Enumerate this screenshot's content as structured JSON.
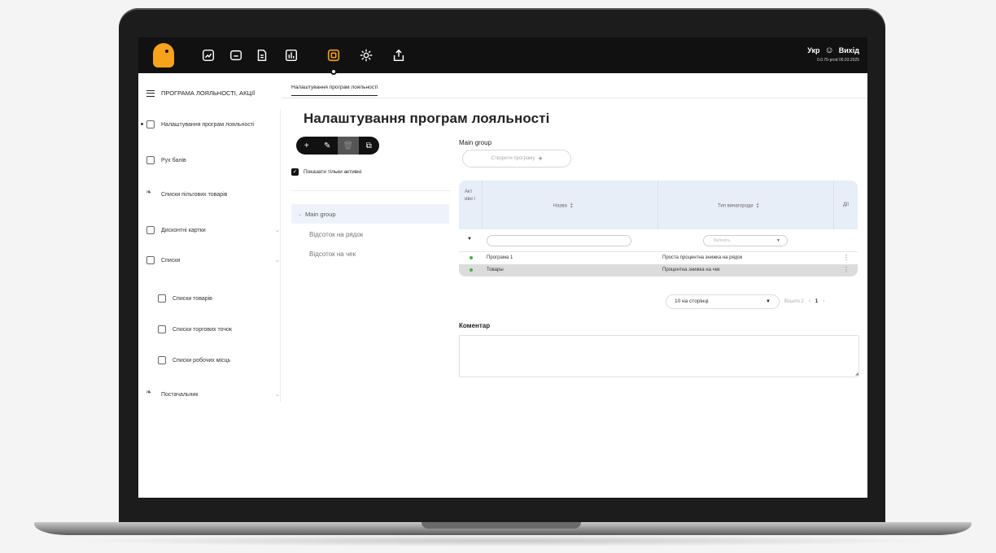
{
  "topbar": {
    "nav_icons": [
      "chart-line-icon",
      "folder-icon",
      "document-icon",
      "bar-chart-icon",
      "loyalty-icon",
      "settings-icon",
      "export-icon"
    ],
    "active_icon": "loyalty-icon",
    "language": "Укр",
    "logout_label": "Вихід",
    "version": "0.0.76-prod 06.03.2025",
    "accent_color": "#f7a21b"
  },
  "sidebar": {
    "title": "ПРОГРАМА ЛОЯЛЬНОСТІ, АКЦІЇ",
    "items": [
      {
        "label": "Налаштування програм лояльності",
        "icon": "list-icon"
      },
      {
        "label": "Рух балів",
        "icon": "list-icon"
      },
      {
        "label": "Списки пільгових товарів",
        "icon": "leaf-icon"
      },
      {
        "label": "Дисконтні картки",
        "icon": "card-icon"
      },
      {
        "label": "Списки",
        "icon": "clipboard-icon"
      },
      {
        "label": "Списки товарів",
        "icon": "clipboard-icon"
      },
      {
        "label": "Списки торгових точок",
        "icon": "clipboard-icon"
      },
      {
        "label": "Списки робочих місць",
        "icon": "clipboard-icon"
      },
      {
        "label": "Постачальник",
        "icon": "leaf-icon"
      }
    ]
  },
  "breadcrumb": {
    "tab": "Налаштування програм лояльності"
  },
  "main": {
    "title": "Налаштування програм лояльності",
    "toolbar": {
      "add": "+",
      "edit": "✎",
      "delete": "🗑",
      "copy": "⧉"
    },
    "show_active_only": "Показати тільки активні",
    "show_active_checked": true,
    "tree": {
      "root": "Main group",
      "children": [
        "Відсоток на рядок",
        "Відсоток на чек"
      ]
    },
    "group_label": "Main group",
    "create_button": "Створити програму",
    "table": {
      "headers": {
        "active": "Акт ивн і",
        "name": "Назва",
        "type": "Тип винагороди",
        "actions": "Дії"
      },
      "filter_placeholder": "Виберіть",
      "rows": [
        {
          "name": "Програма 1",
          "type": "Проста процентна знижка на рядок",
          "active": true
        },
        {
          "name": "Товары",
          "type": "Процентна знижка на чек",
          "active": true
        }
      ]
    },
    "pager": {
      "per_page": "10 на сторінці",
      "total": "Всього 2",
      "current_page": "1"
    },
    "comment_label": "Коментар",
    "comment_value": ""
  }
}
